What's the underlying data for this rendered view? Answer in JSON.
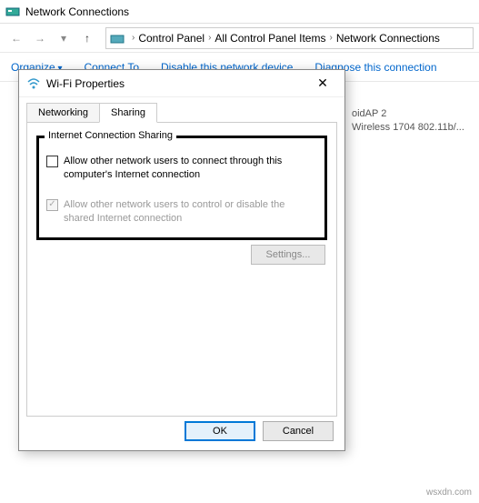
{
  "window": {
    "title": "Network Connections"
  },
  "breadcrumb": {
    "items": [
      "Control Panel",
      "All Control Panel Items",
      "Network Connections"
    ]
  },
  "commands": {
    "organize": "Organize",
    "connect": "Connect To",
    "disable": "Disable this network device",
    "diagnose": "Diagnose this connection"
  },
  "net_item": {
    "name": "oidAP 2",
    "desc": "Wireless 1704 802.11b/..."
  },
  "dialog": {
    "title": "Wi-Fi Properties",
    "tabs": {
      "networking": "Networking",
      "sharing": "Sharing"
    },
    "group_legend": "Internet Connection Sharing",
    "chk1": "Allow other network users to connect through this computer's Internet connection",
    "chk2": "Allow other network users to control or disable the shared Internet connection",
    "settings": "Settings...",
    "ok": "OK",
    "cancel": "Cancel"
  },
  "watermark": "wsxdn.com"
}
